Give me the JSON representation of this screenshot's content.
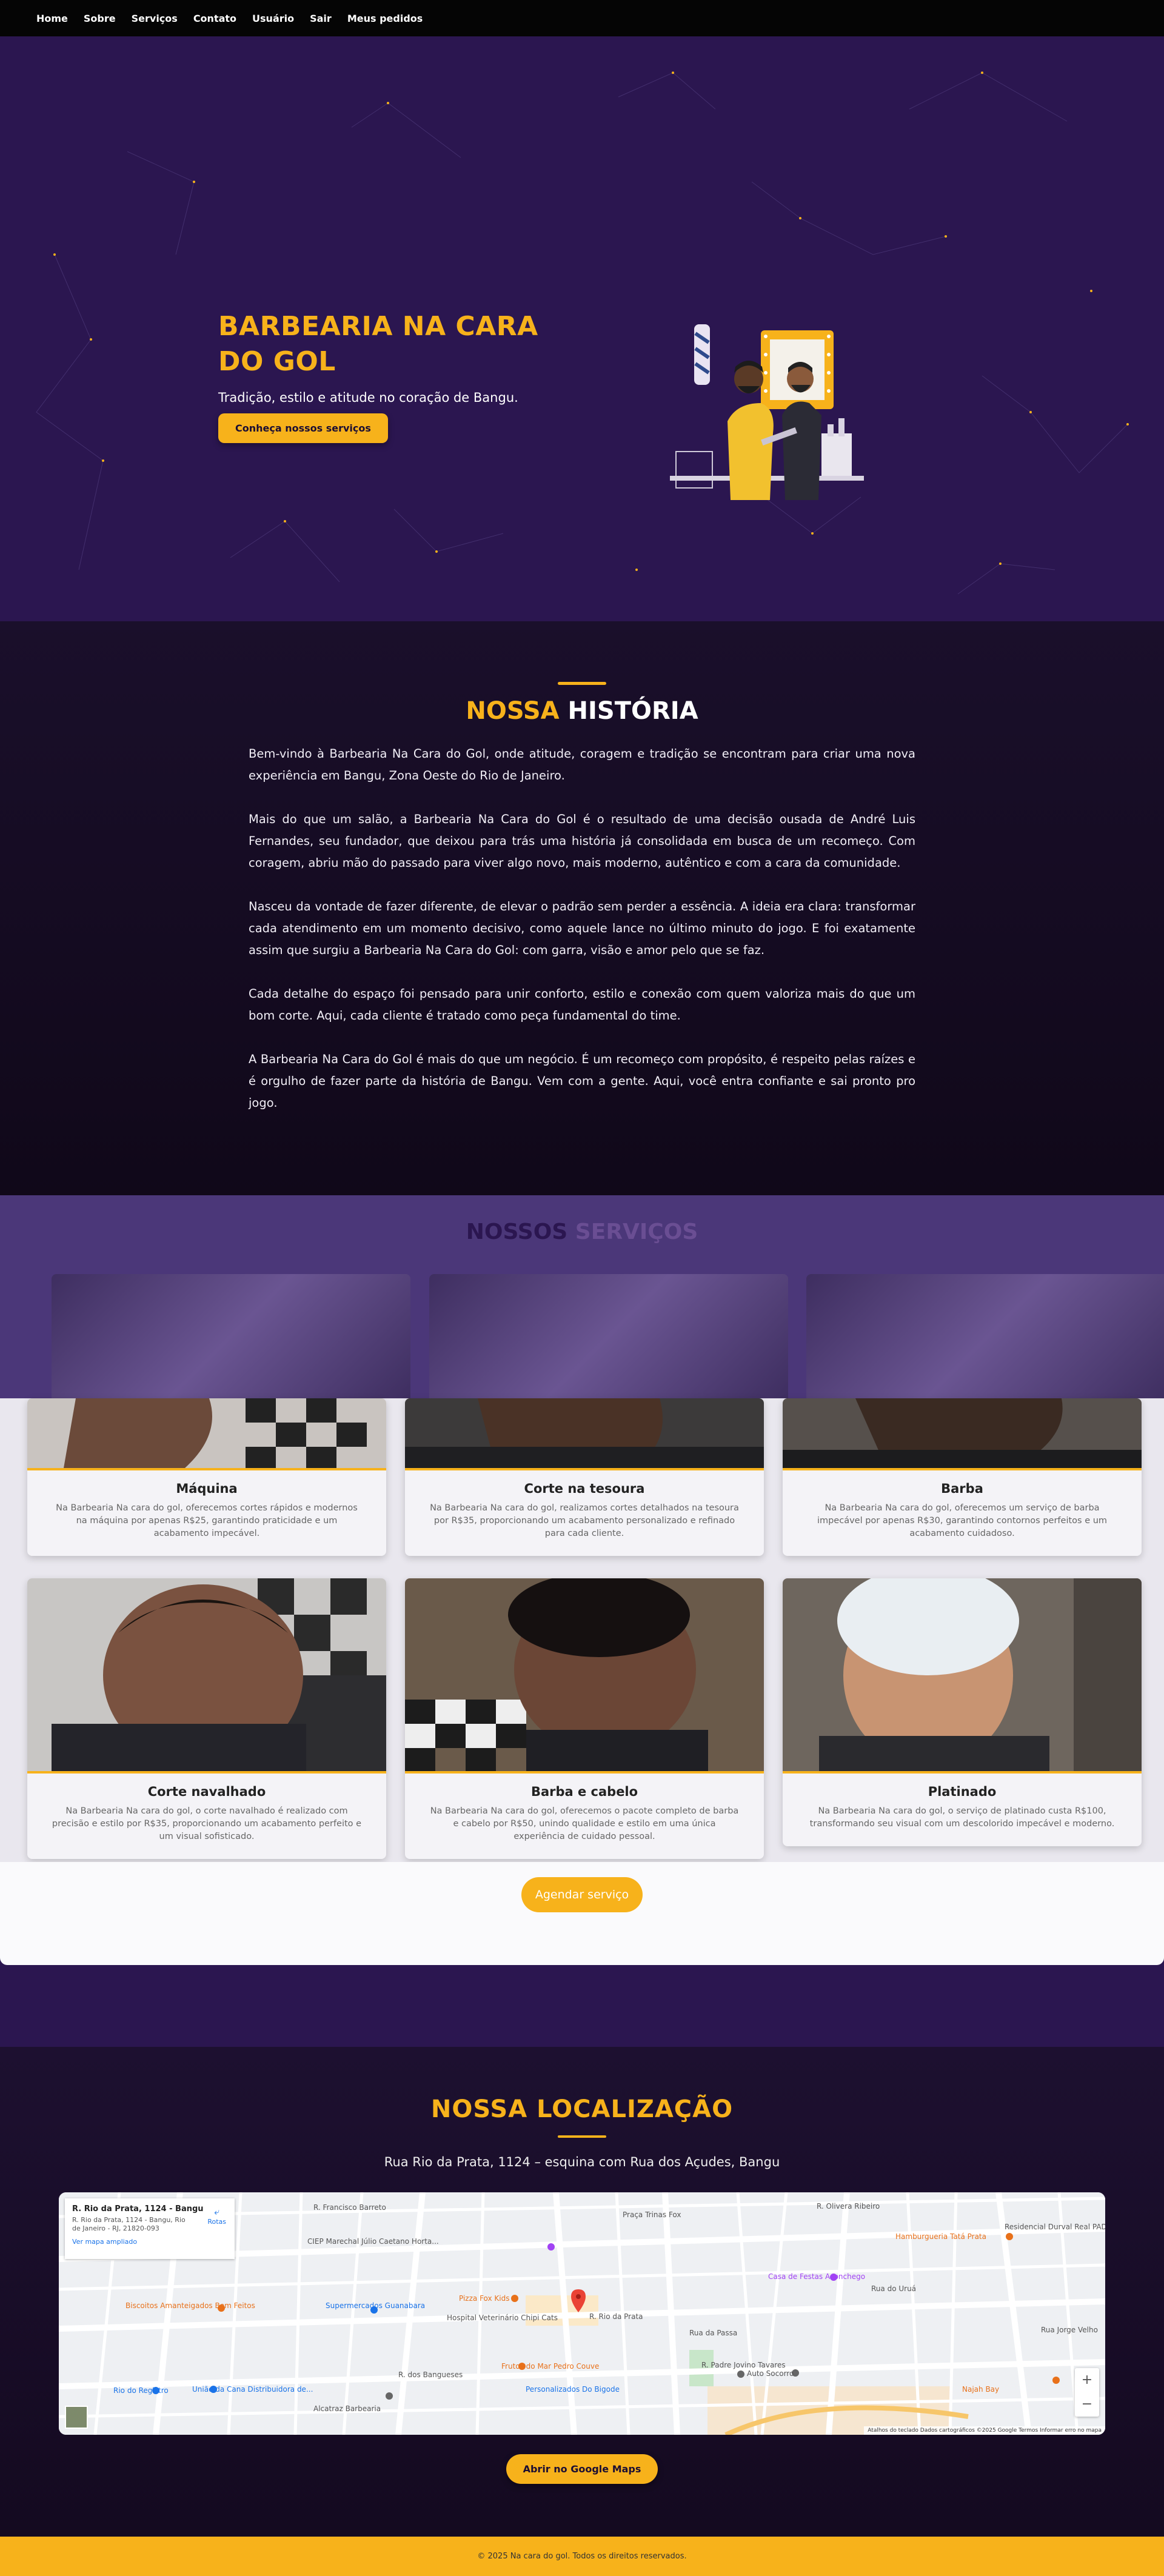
{
  "nav": {
    "items": [
      "Home",
      "Sobre",
      "Serviços",
      "Contato",
      "Usuário",
      "Sair",
      "Meus pedidos"
    ]
  },
  "hero": {
    "title": "BARBEARIA NA CARA DO GOL",
    "subtitle": "Tradição, estilo e atitude no coração de Bangu.",
    "button_label": "Conheça nossos serviços"
  },
  "history": {
    "title_accent": "NOSSA",
    "title_rest": "HISTÓRIA",
    "paragraphs": [
      "Bem-vindo à Barbearia Na Cara do Gol, onde atitude, coragem e tradição se encontram para criar uma nova experiência em Bangu, Zona Oeste do Rio de Janeiro.",
      "Mais do que um salão, a Barbearia Na Cara do Gol é o resultado de uma decisão ousada de André Luis Fernandes, seu fundador, que deixou para trás uma história já consolidada em busca de um recomeço. Com coragem, abriu mão do passado para viver algo novo, mais moderno, autêntico e com a cara da comunidade.",
      "Nasceu da vontade de fazer diferente, de elevar o padrão sem perder a essência. A ideia era clara: transformar cada atendimento em um momento decisivo, como aquele lance no último minuto do jogo. E foi exatamente assim que surgiu a Barbearia Na Cara do Gol: com garra, visão e amor pelo que se faz.",
      "Cada detalhe do espaço foi pensado para unir conforto, estilo e conexão com quem valoriza mais do que um bom corte. Aqui, cada cliente é tratado como peça fundamental do time.",
      "A Barbearia Na Cara do Gol é mais do que um negócio. É um recomeço com propósito, é respeito pelas raízes e é orgulho de fazer parte da história de Bangu. Vem com a gente. Aqui, você entra confiante e sai pronto pro jogo."
    ]
  },
  "services": {
    "title_a": "NOSSOS",
    "title_b": "SERVIÇOS",
    "cards": [
      {
        "name": "Máquina",
        "desc": "Na Barbearia Na cara do gol, oferecemos cortes rápidos e modernos na máquina por apenas R$25, garantindo praticidade e um acabamento impecável."
      },
      {
        "name": "Corte na tesoura",
        "desc": "Na Barbearia Na cara do gol, realizamos cortes detalhados na tesoura por R$35, proporcionando um acabamento personalizado e refinado para cada cliente."
      },
      {
        "name": "Barba",
        "desc": "Na Barbearia Na cara do gol, oferecemos um serviço de barba impecável por apenas R$30, garantindo contornos perfeitos e um acabamento cuidadoso."
      },
      {
        "name": "Corte navalhado",
        "desc": "Na Barbearia Na cara do gol, o corte navalhado é realizado com precisão e estilo por R$35, proporcionando um acabamento perfeito e um visual sofisticado."
      },
      {
        "name": "Barba e cabelo",
        "desc": "Na Barbearia Na cara do gol, oferecemos o pacote completo de barba e cabelo por R$50, unindo qualidade e estilo em uma única experiência de cuidado pessoal."
      },
      {
        "name": "Platinado",
        "desc": "Na Barbearia Na cara do gol, o serviço de platinado custa R$100, transformando seu visual com um descolorido impecável e moderno."
      }
    ],
    "cta_label": "Agendar serviço"
  },
  "location": {
    "title": "NOSSA LOCALIZAÇÃO",
    "address": "Rua Rio da Prata, 1124 – esquina com Rua dos Açudes, Bangu",
    "map": {
      "card_title": "R. Rio da Prata, 1124 - Bangu",
      "card_address": "R. Rio da Prata, 1124 - Bangu, Rio de Janeiro - RJ, 21820-093",
      "card_link": "Ver mapa ampliado",
      "directions_label": "Rotas",
      "labels": [
        "Biscoitos Amanteigados Bem Feitos",
        "CIEP Marechal Júlio Caetano Horta...",
        "Supermercados Guanabara",
        "Pizza Fox Kids",
        "Hospital Veterinário Chipi Cats",
        "R. Rio da Prata",
        "Frutos do Mar Pedro Couve",
        "Personalizados Do Bigode",
        "Casa de Festas Aconchego",
        "Hamburgueria Tatá Prata",
        "Residencial Durval Real PADRE MIGUEL",
        "União da Cana Distribuidora de...",
        "Rio do Registro",
        "Alcatraz Barbearia",
        "Auto Socorro",
        "Najah Bay",
        "R. Francisco Barreto",
        "R. dos Bangueses",
        "R. Olivera Ribeiro",
        "Rua do Uruá",
        "Rua Jorge Velho",
        "Rua da Passa",
        "Praça Trinas Fox",
        "R. Padre Jovino Tavares"
      ],
      "zoom_in": "+",
      "zoom_out": "−",
      "footer": "Atalhos do teclado   Dados cartográficos ©2025 Google   Termos   Informar erro no mapa"
    },
    "button_label": "Abrir no Google Maps"
  },
  "footer": {
    "text": "© 2025 Na cara do gol. Todos os direitos reservados."
  },
  "colors": {
    "accent": "#f7b21b",
    "hero_bg": "#2b1650",
    "dark_bg": "#140a20"
  }
}
